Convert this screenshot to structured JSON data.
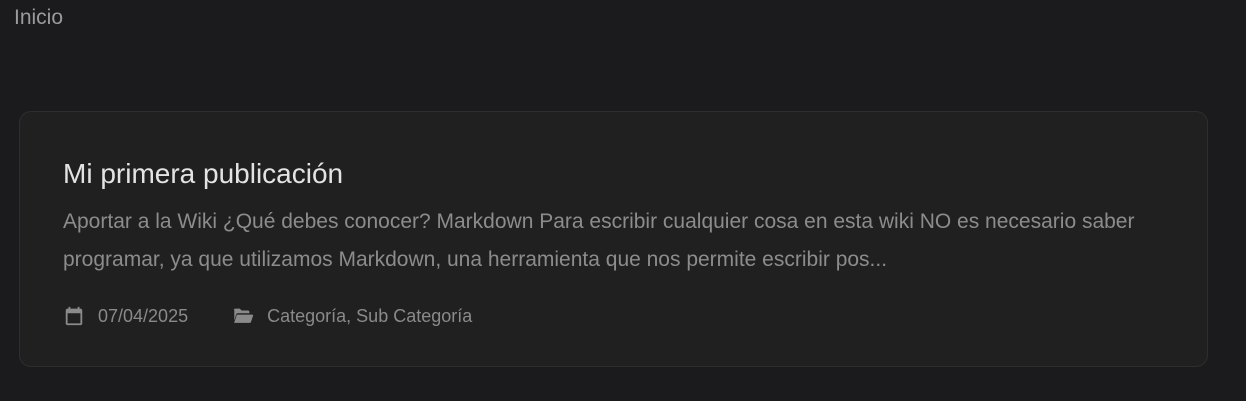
{
  "breadcrumb": {
    "home_label": "Inicio"
  },
  "post": {
    "title": "Mi primera publicación",
    "summary": "Aportar a la Wiki ¿Qué debes conocer? Markdown Para escribir cualquier cosa en esta wiki NO es necesario saber programar, ya que utilizamos Markdown, una herramienta que nos permite escribir pos...",
    "date": "07/04/2025",
    "categories": [
      "Categoría",
      "Sub Categoría"
    ],
    "category_separator": ", "
  },
  "icons": {
    "date": "calendar-icon",
    "categories": "folder-open-icon"
  },
  "colors": {
    "background": "#1b1b1d",
    "card_background": "#202020",
    "card_border": "#2e2e2e",
    "title": "#e3e3e3",
    "text_muted": "#8c8c8c"
  }
}
